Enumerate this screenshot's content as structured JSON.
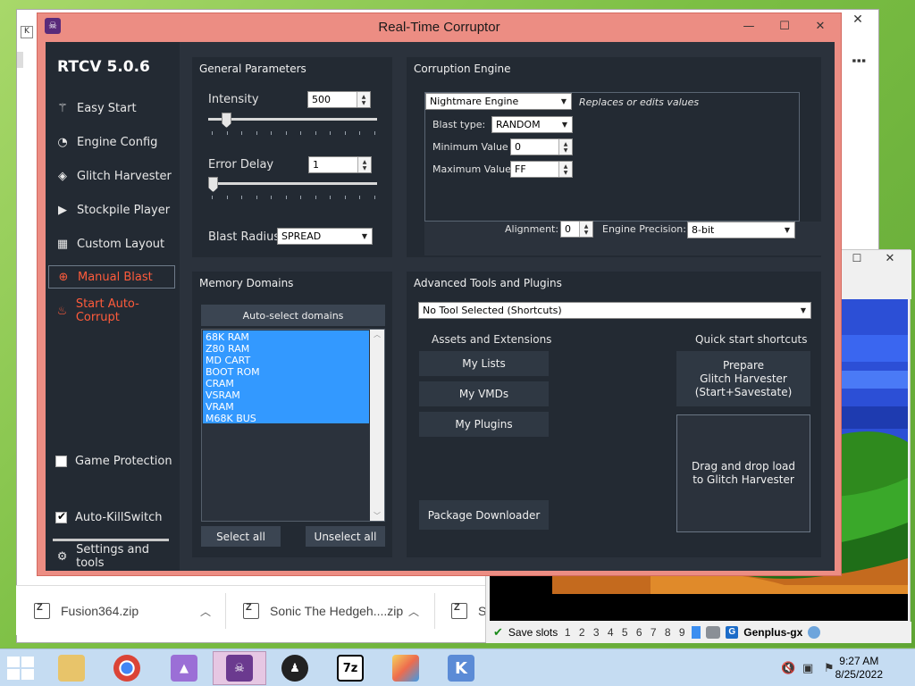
{
  "rtc": {
    "window_title": "Real-Time Corruptor",
    "app_version": "RTCV 5.0.6",
    "sidebar": {
      "items": [
        {
          "label": "Easy Start",
          "icon": "wand-icon"
        },
        {
          "label": "Engine Config",
          "icon": "gauge-icon"
        },
        {
          "label": "Glitch Harvester",
          "icon": "layers-icon"
        },
        {
          "label": "Stockpile Player",
          "icon": "play-icon"
        },
        {
          "label": "Custom Layout",
          "icon": "grid-icon"
        }
      ],
      "manual_blast": "Manual Blast",
      "start_auto_corrupt": "Start Auto-Corrupt",
      "game_protection": "Game Protection",
      "auto_killswitch": "Auto-KillSwitch",
      "settings": "Settings and tools"
    },
    "general": {
      "title": "General Parameters",
      "intensity_label": "Intensity",
      "intensity_value": "500",
      "error_delay_label": "Error Delay",
      "error_delay_value": "1",
      "blast_radius_label": "Blast Radius:",
      "blast_radius_value": "SPREAD"
    },
    "engine": {
      "title": "Corruption Engine",
      "engine_value": "Nightmare Engine",
      "engine_desc": "Replaces or edits values",
      "blast_type_label": "Blast type:",
      "blast_type_value": "RANDOM",
      "min_label": "Minimum Value",
      "min_value": "0",
      "max_label": "Maximum Value",
      "max_value": "FF",
      "alignment_label": "Alignment:",
      "alignment_value": "0",
      "precision_label": "Engine Precision:",
      "precision_value": "8-bit"
    },
    "memory": {
      "title": "Memory Domains",
      "auto_select": "Auto-select domains",
      "domains": [
        "68K RAM",
        "Z80 RAM",
        "MD CART",
        "BOOT ROM",
        "CRAM",
        "VSRAM",
        "VRAM",
        "M68K BUS"
      ],
      "select_all": "Select all",
      "unselect_all": "Unselect all"
    },
    "tools": {
      "title": "Advanced Tools and Plugins",
      "tool_select": "No Tool Selected (Shortcuts)",
      "assets_title": "Assets and Extensions",
      "my_lists": "My Lists",
      "my_vmds": "My VMDs",
      "my_plugins": "My Plugins",
      "package_downloader": "Package Downloader",
      "quick_title": "Quick start shortcuts",
      "prepare": "Prepare\nGlitch Harvester\n(Start+Savestate)",
      "drag_drop": "Drag and drop load\nto Glitch Harvester"
    }
  },
  "browser": {
    "downloads": [
      {
        "name": "Fusion364.zip"
      },
      {
        "name": "Sonic The Hedgeh....zip"
      },
      {
        "name": "S"
      }
    ]
  },
  "emulator": {
    "save_slots_label": "Save slots",
    "slots": [
      "1",
      "2",
      "3",
      "4",
      "5",
      "6",
      "7",
      "8",
      "9",
      "0"
    ],
    "core_name": "Genplus-gx"
  },
  "taskbar": {
    "time": "9:27 AM",
    "date": "8/25/2022",
    "apps": [
      "file-explorer-icon",
      "chrome-icon",
      "app-icon",
      "rtc-icon",
      "anonymous-icon",
      "7zip-icon",
      "paint-icon",
      "kega-icon"
    ]
  },
  "colors": {
    "accent_red": "#ff5b3b",
    "window_border": "#ec8d83",
    "panel_bg": "#232a33",
    "body_bg": "#2b323c",
    "selection_blue": "#3399ff"
  }
}
